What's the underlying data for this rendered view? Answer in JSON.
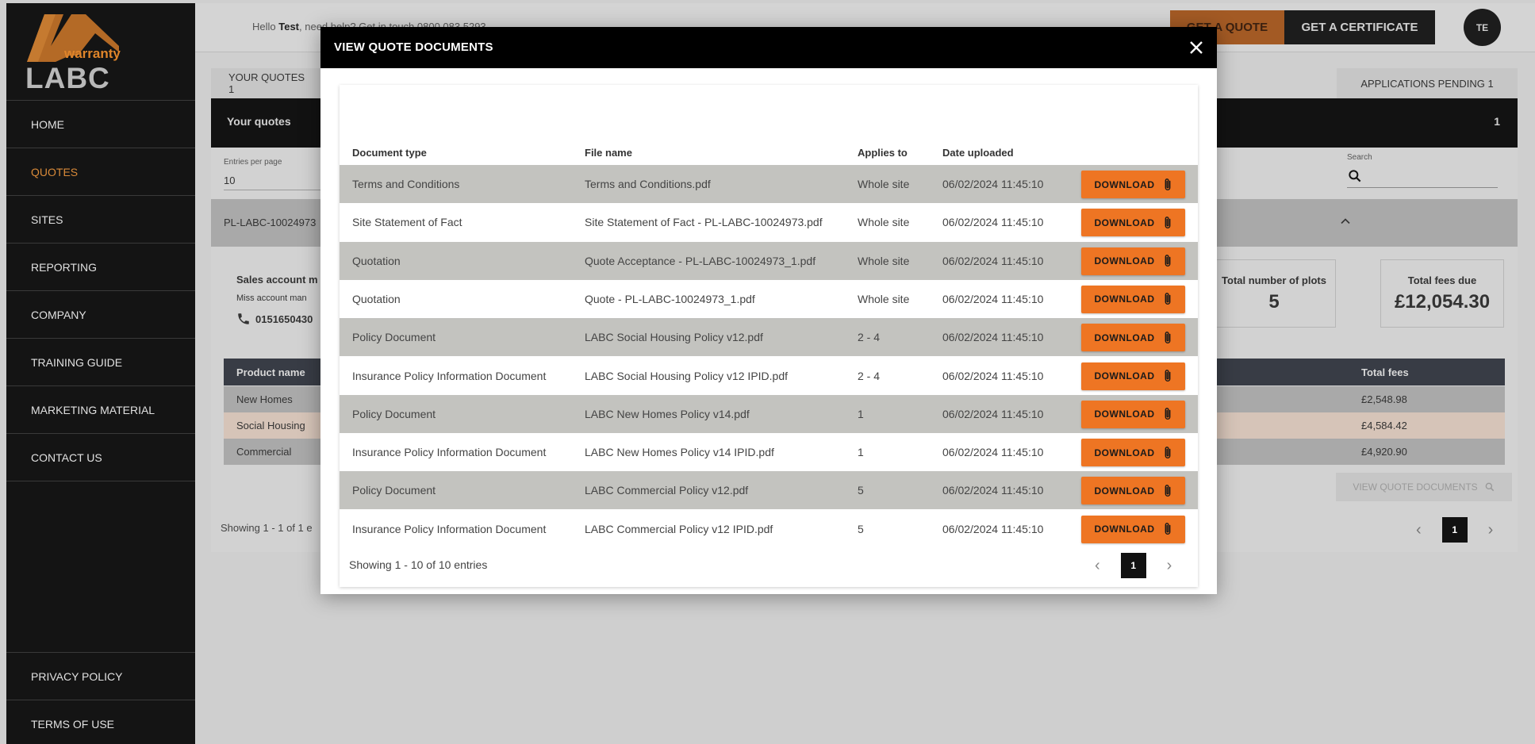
{
  "sidebar": {
    "logo_warranty": "warranty",
    "logo_labc": "LABC",
    "items": [
      {
        "label": "HOME"
      },
      {
        "label": "QUOTES"
      },
      {
        "label": "SITES"
      },
      {
        "label": "REPORTING"
      },
      {
        "label": "COMPANY"
      },
      {
        "label": "TRAINING GUIDE"
      },
      {
        "label": "MARKETING MATERIAL"
      },
      {
        "label": "CONTACT US"
      }
    ],
    "bottom_items": [
      {
        "label": "PRIVACY POLICY"
      },
      {
        "label": "TERMS OF USE"
      }
    ],
    "active_color": "#d98a39"
  },
  "header": {
    "hello_prefix": "Hello ",
    "user_name": "Test",
    "help_text": ", need help? Get in touch 0800 083 5293",
    "get_quote": "GET A QUOTE",
    "get_certificate": "GET A CERTIFICATE",
    "avatar_initials": "TE"
  },
  "background": {
    "tab_left": "YOUR QUOTES  1",
    "tab_right": "APPLICATIONS PENDING  1",
    "bar_title": "Your quotes",
    "bar_count": "1",
    "entries_label": "Entries per page",
    "entries_value": "10",
    "search_label": "Search",
    "reference": "PL-LABC-10024973",
    "sales_label": "Sales account m",
    "miss_label": "Miss account man",
    "phone": "0151650430",
    "total_plots_label": "Total number of plots",
    "total_plots_value": "5",
    "total_fees_label": "Total fees due",
    "total_fees_value": "£12,054.30",
    "table_head_product": "Product name",
    "table_head_fees": "Total fees",
    "rows": [
      {
        "name": "New Homes",
        "fees": "£2,548.98"
      },
      {
        "name": "Social Housing",
        "fees": "£4,584.42"
      },
      {
        "name": "Commercial",
        "fees": "£4,920.90"
      }
    ],
    "view_docs": "VIEW QUOTE DOCUMENTS",
    "showing": "Showing 1 - 1 of 1 e",
    "page": "1"
  },
  "modal": {
    "title": "VIEW QUOTE DOCUMENTS",
    "columns": [
      "Document type",
      "File name",
      "Applies to",
      "Date uploaded"
    ],
    "download_label": "DOWNLOAD",
    "rows": [
      {
        "type": "Terms and Conditions",
        "file": "Terms and Conditions.pdf",
        "applies": "Whole site",
        "date": "06/02/2024 11:45:10"
      },
      {
        "type": "Site Statement of Fact",
        "file": "Site Statement of Fact - PL-LABC-10024973.pdf",
        "applies": "Whole site",
        "date": "06/02/2024 11:45:10"
      },
      {
        "type": "Quotation",
        "file": "Quote Acceptance - PL-LABC-10024973_1.pdf",
        "applies": "Whole site",
        "date": "06/02/2024 11:45:10"
      },
      {
        "type": "Quotation",
        "file": "Quote - PL-LABC-10024973_1.pdf",
        "applies": "Whole site",
        "date": "06/02/2024 11:45:10"
      },
      {
        "type": "Policy Document",
        "file": "LABC Social Housing Policy v12.pdf",
        "applies": "2 - 4",
        "date": "06/02/2024 11:45:10"
      },
      {
        "type": "Insurance Policy Information Document",
        "file": "LABC Social Housing Policy v12 IPID.pdf",
        "applies": "2 - 4",
        "date": "06/02/2024 11:45:10"
      },
      {
        "type": "Policy Document",
        "file": "LABC New Homes Policy v14.pdf",
        "applies": "1",
        "date": "06/02/2024 11:45:10"
      },
      {
        "type": "Insurance Policy Information Document",
        "file": "LABC New Homes Policy v14 IPID.pdf",
        "applies": "1",
        "date": "06/02/2024 11:45:10"
      },
      {
        "type": "Policy Document",
        "file": "LABC Commercial Policy v12.pdf",
        "applies": "5",
        "date": "06/02/2024 11:45:10"
      },
      {
        "type": "Insurance Policy Information Document",
        "file": "LABC Commercial Policy v12 IPID.pdf",
        "applies": "5",
        "date": "06/02/2024 11:45:10"
      }
    ],
    "showing": "Showing 1 - 10 of 10 entries",
    "page": "1",
    "accent_color": "#ee7523"
  }
}
